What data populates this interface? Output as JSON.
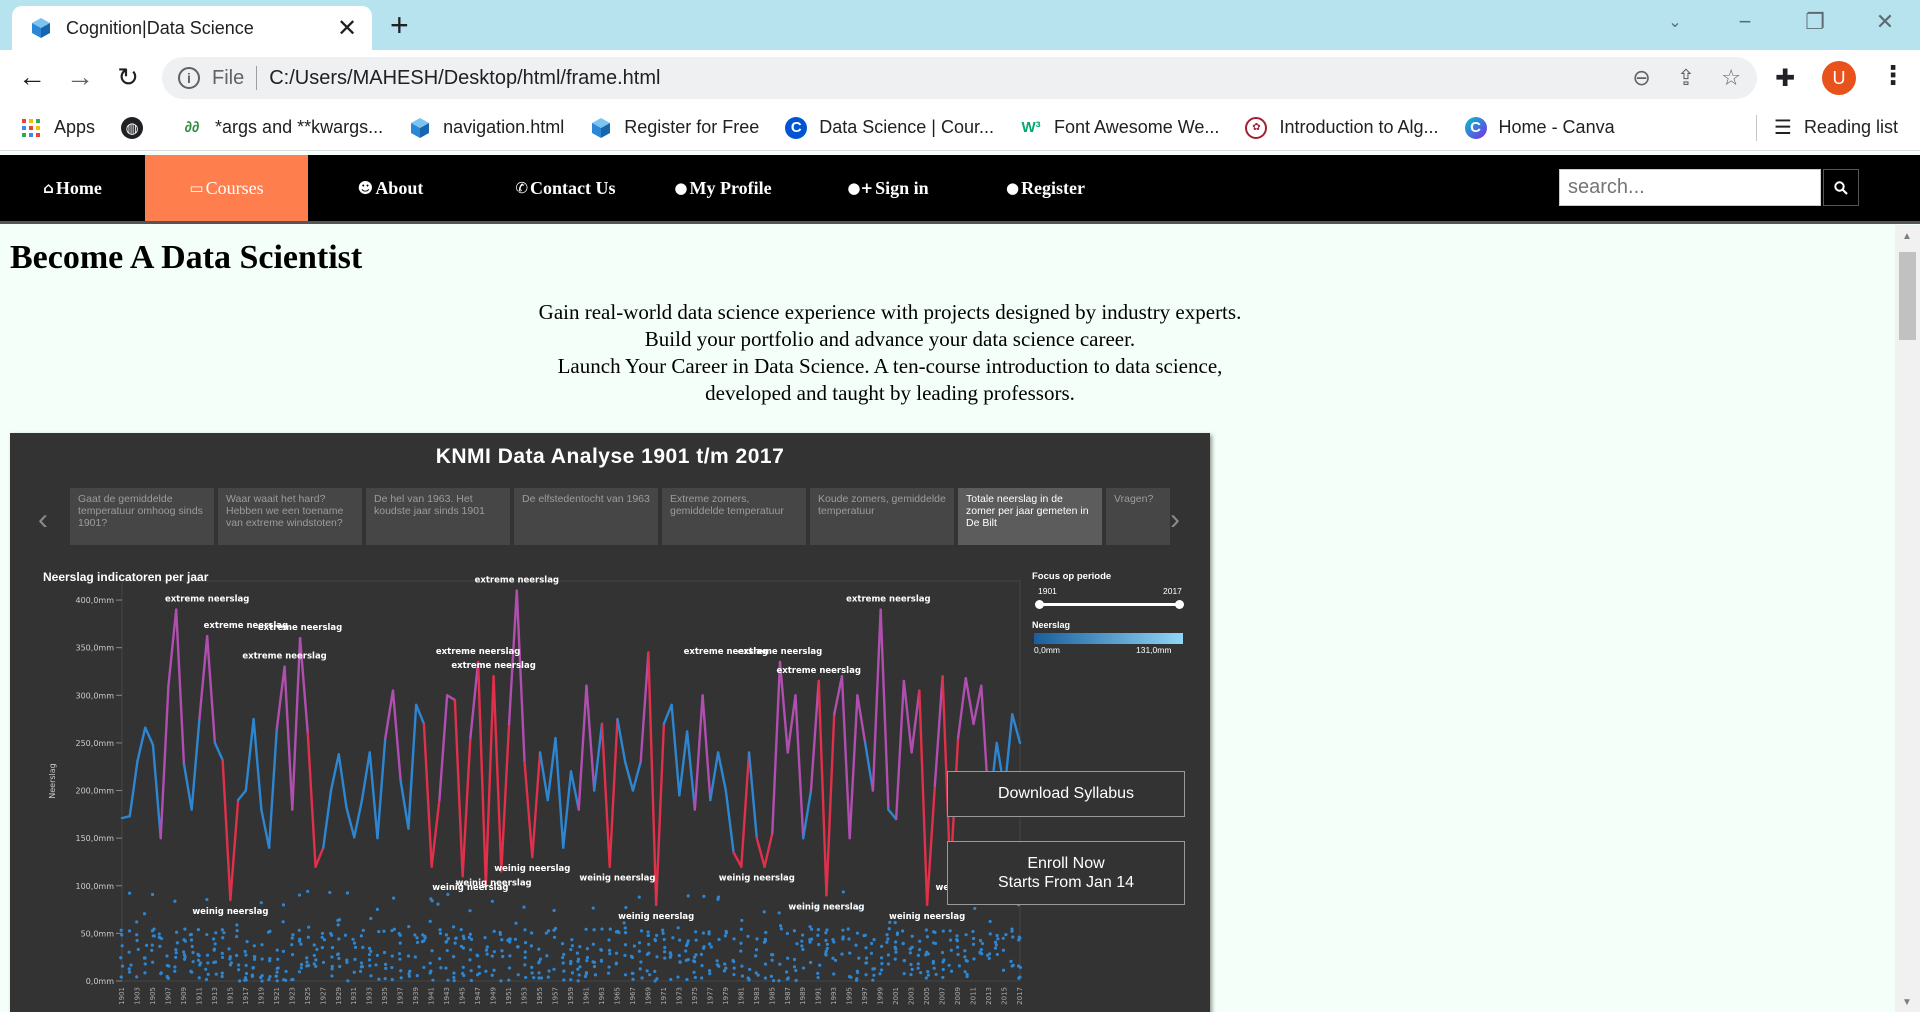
{
  "browser": {
    "tab_title": "Cognition|Data Science",
    "scheme": "File",
    "url": "C:/Users/MAHESH/Desktop/html/frame.html",
    "profile_initial": "U",
    "bookmarks": [
      {
        "label": "Apps",
        "icon": "apps-grid-icon"
      },
      {
        "label": "",
        "icon": "globe-icon"
      },
      {
        "label": "*args and **kwargs...",
        "icon": "gfg-icon"
      },
      {
        "label": "navigation.html",
        "icon": "cube-icon"
      },
      {
        "label": "Register for Free",
        "icon": "cube-icon"
      },
      {
        "label": "Data Science | Cour...",
        "icon": "coursera-icon"
      },
      {
        "label": "Font Awesome We...",
        "icon": "w3-icon"
      },
      {
        "label": "Introduction to Alg...",
        "icon": "mit-icon"
      },
      {
        "label": "Home - Canva",
        "icon": "canva-icon"
      }
    ],
    "reading_list": "Reading list"
  },
  "site": {
    "nav": [
      {
        "label": "Home",
        "icon": "home-icon"
      },
      {
        "label": "Courses",
        "icon": "book-icon"
      },
      {
        "label": "About",
        "icon": "users-icon"
      },
      {
        "label": "Contact Us",
        "icon": "phone-icon"
      },
      {
        "label": "My Profile",
        "icon": "user-icon"
      },
      {
        "label": "Sign in",
        "icon": "user-plus-icon"
      },
      {
        "label": "Register",
        "icon": "user-icon"
      }
    ],
    "search_placeholder": "search...",
    "title": "Become A Data Scientist",
    "intro": [
      "Gain real-world data science experience with projects designed by industry experts.",
      "Build your portfolio and advance your data science career.",
      "Launch Your Career in Data Science. A ten-course introduction to data science,",
      "developed and taught by leading professors."
    ],
    "buttons": {
      "download": "Download Syllabus",
      "enroll_line1": "Enroll Now",
      "enroll_line2": "Starts From Jan 14"
    }
  },
  "dashboard": {
    "title": "KNMI Data Analyse 1901 t/m 2017",
    "tabs": [
      "Gaat de gemiddelde temperatuur omhoog sinds 1901?",
      "Waar waait het hard? Hebben we een toename van extreme windstoten?",
      "De hel van 1963. Het koudste jaar sinds 1901",
      "De elfstedentocht van 1963",
      "Extreme zomers, gemiddelde temperatuur",
      "Koude zomers, gemiddelde temperatuur",
      "Totale neerslag in de zomer per jaar gemeten in De Bilt",
      "Vragen?"
    ],
    "selected_tab": 6,
    "focus_label": "Focus op periode",
    "focus_from": "1901",
    "focus_to": "2017",
    "legend_label": "Neerslag",
    "legend_min": "0,0mm",
    "legend_max": "131,0mm",
    "colors": {
      "line": "#2e86d1",
      "extreme": "#b04fb0",
      "low": "#e0304a",
      "dot": "#2e86d1"
    }
  },
  "chart_data": {
    "type": "line",
    "title": "Neerslag indicatoren per jaar",
    "ylabel": "Neerslag",
    "xlabel": "",
    "ylim": [
      0,
      420
    ],
    "yticks": [
      "0,0mm",
      "50,0mm",
      "100,0mm",
      "150,0mm",
      "200,0mm",
      "250,0mm",
      "300,0mm",
      "350,0mm",
      "400,0mm"
    ],
    "x_start": 1901,
    "x_end": 2017,
    "values": [
      171,
      173,
      231,
      266,
      248,
      150,
      310,
      390,
      228,
      180,
      275,
      362,
      250,
      232,
      85,
      190,
      200,
      275,
      180,
      140,
      265,
      330,
      180,
      360,
      260,
      120,
      140,
      200,
      238,
      182,
      151,
      190,
      240,
      150,
      254,
      305,
      210,
      160,
      290,
      270,
      120,
      190,
      300,
      295,
      110,
      255,
      335,
      100,
      320,
      115,
      270,
      410,
      230,
      130,
      240,
      190,
      255,
      140,
      220,
      180,
      310,
      200,
      270,
      120,
      275,
      230,
      200,
      230,
      345,
      80,
      270,
      290,
      195,
      262,
      180,
      300,
      190,
      240,
      200,
      135,
      120,
      240,
      150,
      120,
      155,
      335,
      240,
      300,
      150,
      200,
      315,
      90,
      280,
      320,
      150,
      300,
      250,
      200,
      390,
      180,
      170,
      315,
      240,
      305,
      80,
      205,
      320,
      110,
      255,
      318,
      270,
      310,
      180,
      250,
      200,
      280,
      250
    ],
    "annotations": [
      {
        "label": "extreme neerslag",
        "year": 1912,
        "value": 390
      },
      {
        "label": "extreme neerslag",
        "year": 1917,
        "value": 362
      },
      {
        "label": "extreme neerslag",
        "year": 1924,
        "value": 360
      },
      {
        "label": "extreme neerslag",
        "year": 1922,
        "value": 330
      },
      {
        "label": "extreme neerslag",
        "year": 1952,
        "value": 410
      },
      {
        "label": "extreme neerslag",
        "year": 1947,
        "value": 335
      },
      {
        "label": "extreme neerslag",
        "year": 1949,
        "value": 320
      },
      {
        "label": "extreme neerslag",
        "year": 1986,
        "value": 335
      },
      {
        "label": "extreme neerslag",
        "year": 1991,
        "value": 315
      },
      {
        "label": "extreme neerslag",
        "year": 1979,
        "value": 335
      },
      {
        "label": "extreme neerslag",
        "year": 2000,
        "value": 390
      },
      {
        "label": "weinig neerslag",
        "year": 1915,
        "value": 85
      },
      {
        "label": "weinig neerslag",
        "year": 1949,
        "value": 115
      },
      {
        "label": "weinig neerslag",
        "year": 1946,
        "value": 110
      },
      {
        "label": "weinig neerslag",
        "year": 1954,
        "value": 130
      },
      {
        "label": "weinig neerslag",
        "year": 1970,
        "value": 80
      },
      {
        "label": "weinig neerslag",
        "year": 1965,
        "value": 120
      },
      {
        "label": "weinig neerslag",
        "year": 1983,
        "value": 120
      },
      {
        "label": "weinig neerslag",
        "year": 1992,
        "value": 90
      },
      {
        "label": "weinig neerslag",
        "year": 2005,
        "value": 80
      },
      {
        "label": "weinig neerslag",
        "year": 2011,
        "value": 110
      }
    ]
  }
}
